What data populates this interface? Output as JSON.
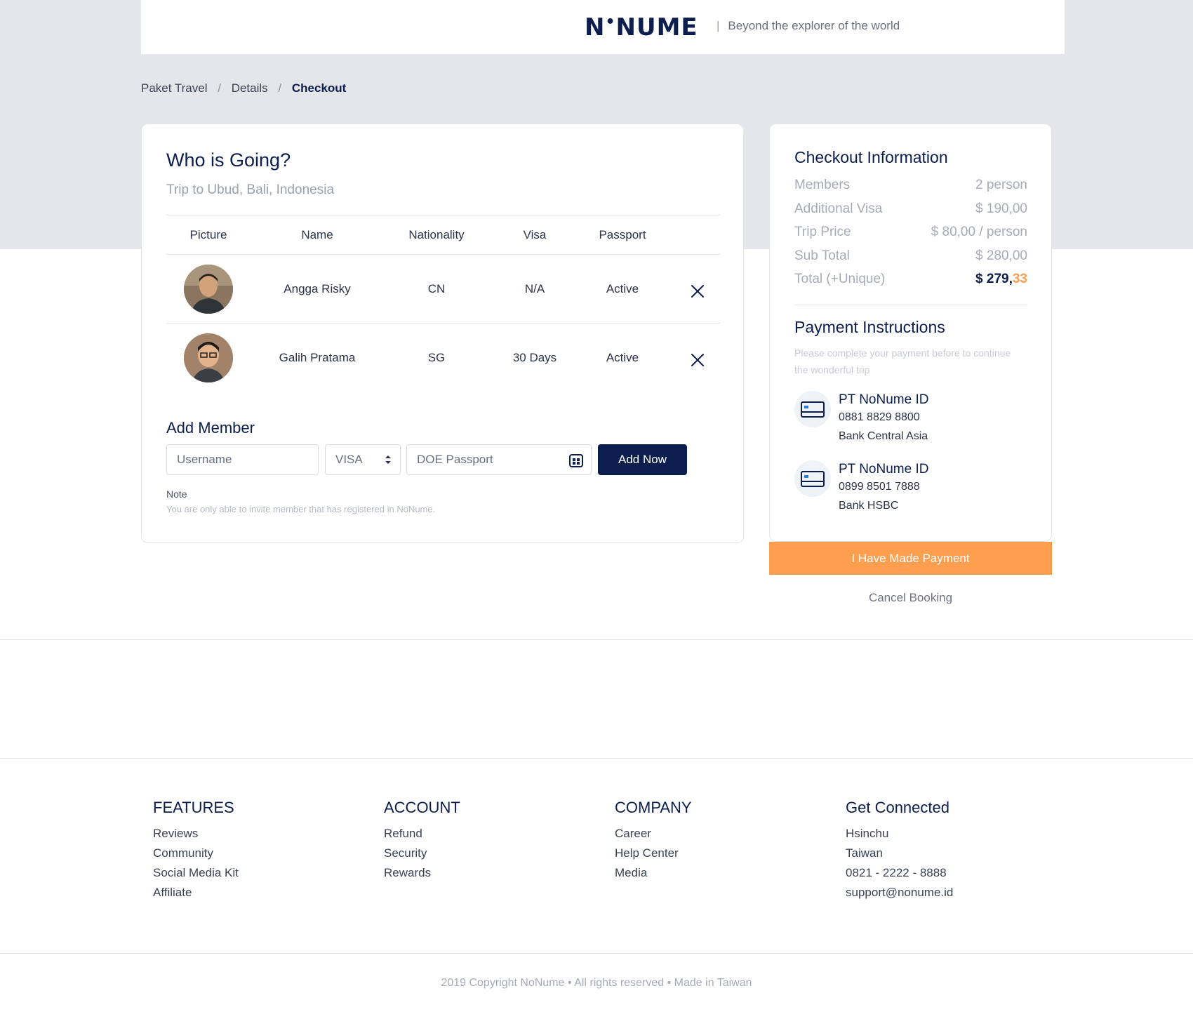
{
  "header": {
    "logo_left": "N",
    "logo_mid": "•",
    "logo_right": "NUME",
    "separator": "|",
    "tagline": "Beyond the explorer of the world"
  },
  "breadcrumb": {
    "items": [
      "Paket Travel",
      "Details",
      "Checkout"
    ],
    "separator": "/"
  },
  "going": {
    "title": "Who is Going?",
    "subtitle": "Trip to Ubud, Bali, Indonesia",
    "columns": [
      "Picture",
      "Name",
      "Nationality",
      "Visa",
      "Passport"
    ],
    "rows": [
      {
        "name": "Angga Risky",
        "nationality": "CN",
        "visa": "N/A",
        "passport": "Active"
      },
      {
        "name": "Galih Pratama",
        "nationality": "SG",
        "visa": "30 Days",
        "passport": "Active"
      }
    ]
  },
  "add_member": {
    "title": "Add Member",
    "username_placeholder": "Username",
    "visa_value": "VISA",
    "doe_placeholder": "DOE Passport",
    "button": "Add Now",
    "note_label": "Note",
    "note_text": "You are only able to invite member that has registered in NoNume."
  },
  "checkout": {
    "title": "Checkout Information",
    "rows": [
      {
        "label": "Members",
        "value": "2 person"
      },
      {
        "label": "Additional Visa",
        "value": "$ 190,00"
      },
      {
        "label": "Trip Price",
        "value": "$ 80,00 / person"
      },
      {
        "label": "Sub Total",
        "value": "$ 280,00"
      }
    ],
    "total_label": "Total (+Unique)",
    "total_main": "$ 279,",
    "total_cents": "33"
  },
  "payment": {
    "title": "Payment Instructions",
    "note": "Please complete your payment before to continue the wonderful trip",
    "banks": [
      {
        "name": "PT NoNume ID",
        "account": "0881 8829 8800",
        "bank": "Bank Central Asia"
      },
      {
        "name": "PT NoNume ID",
        "account": "0899 8501 7888",
        "bank": "Bank HSBC"
      }
    ],
    "confirm_button": "I Have Made Payment",
    "cancel_link": "Cancel Booking"
  },
  "footer": {
    "columns": [
      {
        "title": "FEATURES",
        "items": [
          "Reviews",
          "Community",
          "Social Media Kit",
          "Affiliate"
        ]
      },
      {
        "title": "ACCOUNT",
        "items": [
          "Refund",
          "Security",
          "Rewards"
        ]
      },
      {
        "title": "COMPANY",
        "items": [
          "Career",
          "Help Center",
          "Media"
        ]
      },
      {
        "title": "Get Connected",
        "items": [
          "Hsinchu",
          "Taiwan",
          "0821 - 2222 - 8888",
          "support@nonume.id"
        ]
      }
    ],
    "copyright": "2019 Copyright NoNume • All rights reserved • Made in Taiwan"
  },
  "colors": {
    "primary": "#0c1e4e",
    "accent": "#ff9e4f",
    "band": "#e5e6ea"
  }
}
